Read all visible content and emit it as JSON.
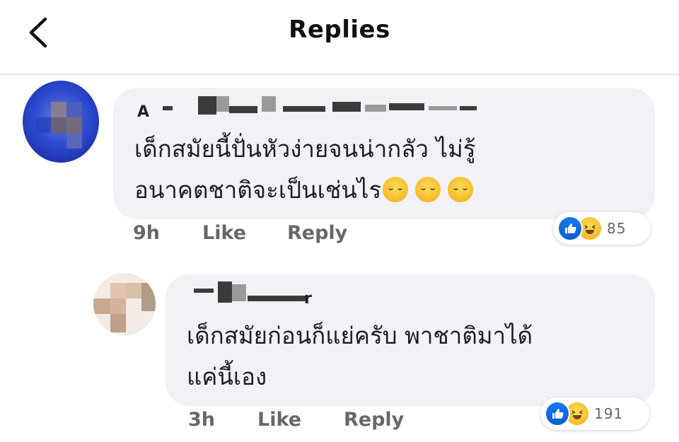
{
  "header": {
    "title": "Replies",
    "back_icon": "chevron-left-icon"
  },
  "comments": [
    {
      "author_visible": "A",
      "text": "เด็กสมัยนี้ปั่นหัวง่ายจนน่ากลัว ไม่รู้\nอนาคตชาติจะเป็นเช่นไร",
      "emoji": [
        "pensive-emoji",
        "pensive-emoji",
        "pensive-emoji"
      ],
      "time": "9h",
      "like_label": "Like",
      "reply_label": "Reply",
      "reaction_icons": [
        "like",
        "haha"
      ],
      "reaction_count": "85"
    },
    {
      "author_visible": "r",
      "text": "เด็กสมัยก่อนก็แย่ครับ พาชาติมาได้\nแค่นี้เอง",
      "time": "3h",
      "like_label": "Like",
      "reply_label": "Reply",
      "reaction_icons": [
        "like",
        "haha"
      ],
      "reaction_count": "191"
    }
  ],
  "colors": {
    "bubble": "#f0f2f5",
    "meta_text": "#65676b",
    "like_blue": "#1877f2",
    "haha_yellow": "#f7b928"
  }
}
